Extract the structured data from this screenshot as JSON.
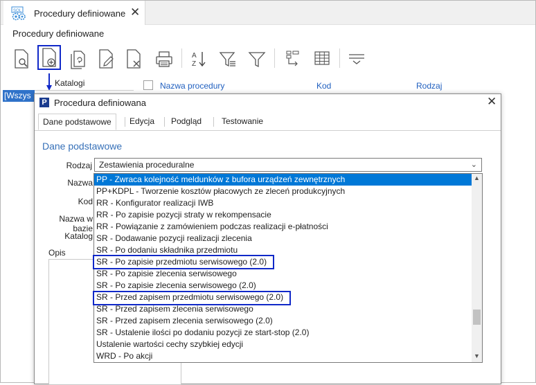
{
  "window": {
    "tab_title": "Procedury definiowane",
    "page_title": "Procedury definiowane"
  },
  "toolbar": {
    "icons": [
      "preview-icon",
      "new-document-icon",
      "copy-document-icon",
      "edit-document-icon",
      "delete-document-icon",
      "print-icon",
      "sort-az-icon",
      "filter-advanced-icon",
      "filter-icon",
      "tree-icon",
      "grid-icon",
      "menu-icon"
    ]
  },
  "left_panel": {
    "header": "Katalogi",
    "selected_item": "[Wszys"
  },
  "grid": {
    "columns": [
      "Nazwa procedury",
      "Kod",
      "Rodzaj"
    ]
  },
  "dialog": {
    "title": "Procedura definiowana",
    "tabs": [
      {
        "label": "Dane podstawowe",
        "active": true
      },
      {
        "label": "Edycja",
        "active": false
      },
      {
        "label": "Podgląd",
        "active": false
      },
      {
        "label": "Testowanie",
        "active": false
      }
    ],
    "section_title": "Dane podstawowe",
    "fields": {
      "rodzaj_label": "Rodzaj",
      "rodzaj_value": "Zestawienia proceduralne",
      "nazwa_label": "Nazwa",
      "kod_label": "Kod",
      "nazwa_w_bazie_label": "Nazwa w bazie",
      "katalog_label": "Katalog",
      "opis_label": "Opis"
    },
    "dropdown_items": [
      {
        "label": "PP - Zwraca kolejność meldunków z bufora urządzeń zewnętrznych",
        "selected": true,
        "highlighted": false
      },
      {
        "label": "PP+KDPL - Tworzenie kosztów płacowych ze zleceń produkcyjnych",
        "selected": false,
        "highlighted": false
      },
      {
        "label": "RR - Konfigurator realizacji IWB",
        "selected": false,
        "highlighted": false
      },
      {
        "label": "RR - Po zapisie pozycji straty w rekompensacie",
        "selected": false,
        "highlighted": false
      },
      {
        "label": "RR - Powiązanie z zamówieniem podczas realizacji e-płatności",
        "selected": false,
        "highlighted": false
      },
      {
        "label": "SR - Dodawanie pozycji realizacji zlecenia",
        "selected": false,
        "highlighted": false
      },
      {
        "label": "SR - Po dodaniu składnika przedmiotu",
        "selected": false,
        "highlighted": false
      },
      {
        "label": "SR - Po zapisie przedmiotu serwisowego (2.0)",
        "selected": false,
        "highlighted": true
      },
      {
        "label": "SR - Po zapisie zlecenia serwisowego",
        "selected": false,
        "highlighted": false
      },
      {
        "label": "SR - Po zapisie zlecenia serwisowego (2.0)",
        "selected": false,
        "highlighted": false
      },
      {
        "label": "SR - Przed zapisem przedmiotu serwisowego (2.0)",
        "selected": false,
        "highlighted": true
      },
      {
        "label": "SR - Przed zapisem zlecenia serwisowego",
        "selected": false,
        "highlighted": false
      },
      {
        "label": "SR - Przed zapisem zlecenia serwisowego (2.0)",
        "selected": false,
        "highlighted": false
      },
      {
        "label": "SR - Ustalenie ilości po dodaniu pozycji ze start-stop (2.0)",
        "selected": false,
        "highlighted": false
      },
      {
        "label": "Ustalenie wartości cechy szybkiej edycji",
        "selected": false,
        "highlighted": false
      },
      {
        "label": "WRD - Po akcji",
        "selected": false,
        "highlighted": false
      }
    ]
  },
  "colors": {
    "highlight_box": "#1028c8",
    "selection": "#0078d7",
    "section_title": "#3670b8",
    "grid_header": "#1f5fbf"
  }
}
